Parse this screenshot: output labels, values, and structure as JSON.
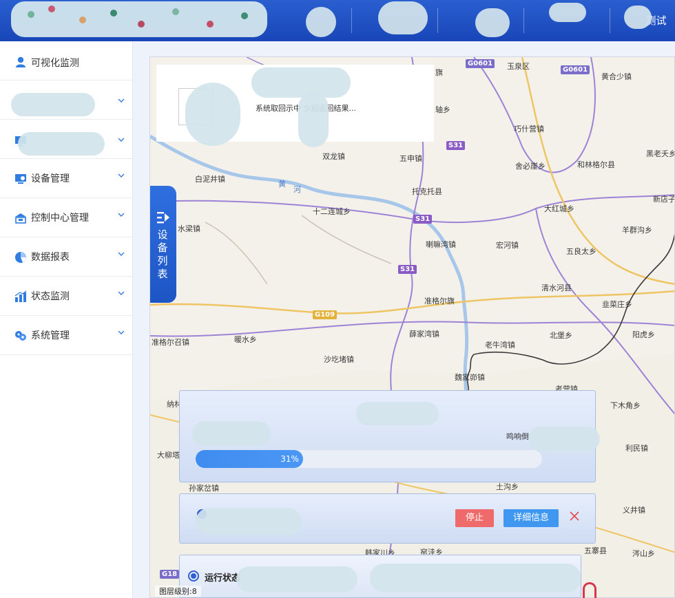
{
  "header": {
    "brand": "",
    "nav": [
      "",
      "",
      "",
      "",
      "测试"
    ]
  },
  "sidebar": {
    "items": [
      {
        "label": "可视化监测",
        "icon": "user-location-icon",
        "chevron": false
      },
      {
        "label": "",
        "icon": "",
        "chevron": true
      },
      {
        "label": "",
        "icon": "monitor-icon",
        "chevron": true
      },
      {
        "label": "设备管理",
        "icon": "device-screen-icon",
        "chevron": true
      },
      {
        "label": "控制中心管理",
        "icon": "building-icon",
        "chevron": true
      },
      {
        "label": "数据报表",
        "icon": "pie-chart-icon",
        "chevron": true
      },
      {
        "label": "状态监测",
        "icon": "bar-chart-icon",
        "chevron": true
      },
      {
        "label": "系统管理",
        "icon": "gear-cluster-icon",
        "chevron": true
      }
    ]
  },
  "notice": {
    "text": "系统取回示中  少后返回结果..."
  },
  "device_tab": {
    "label": "设备列表"
  },
  "progress_panel": {
    "right_text": "鸣响倒",
    "percent_label": "31%",
    "percent": 31
  },
  "action_panel": {
    "stop_label": "停止",
    "detail_label": "详细信息",
    "close_icon": "close-icon"
  },
  "status_panel": {
    "title": "运行状态"
  },
  "map": {
    "scale_label": "图层级别:8",
    "labels": [
      {
        "t": "玉泉区",
        "k": "l1"
      },
      {
        "t": "黄合少镇",
        "k": "l2"
      },
      {
        "t": "巧什营镇",
        "k": "l3"
      },
      {
        "t": "舍必崖乡",
        "k": "l4"
      },
      {
        "t": "和林格尔县",
        "k": "l5"
      },
      {
        "t": "黑老夭乡",
        "k": "l6"
      },
      {
        "t": "双龙镇",
        "k": "l7"
      },
      {
        "t": "五申镇",
        "k": "l8"
      },
      {
        "t": "白泥井镇",
        "k": "l9"
      },
      {
        "t": "托克托县",
        "k": "l10"
      },
      {
        "t": "新店子",
        "k": "l11"
      },
      {
        "t": "十二连城乡",
        "k": "l12"
      },
      {
        "t": "大红城乡",
        "k": "l13"
      },
      {
        "t": "羊群沟乡",
        "k": "l14"
      },
      {
        "t": "水梁镇",
        "k": "l15"
      },
      {
        "t": "喇嘛湾镇",
        "k": "l16"
      },
      {
        "t": "宏河镇",
        "k": "l17"
      },
      {
        "t": "五良太乡",
        "k": "l18"
      },
      {
        "t": "清水河县",
        "k": "l19"
      },
      {
        "t": "准格尔旗",
        "k": "l20"
      },
      {
        "t": "韭菜庄乡",
        "k": "l21"
      },
      {
        "t": "薛家湾镇",
        "k": "l22"
      },
      {
        "t": "准格尔召镇",
        "k": "l23"
      },
      {
        "t": "暖水乡",
        "k": "l24"
      },
      {
        "t": "北堡乡",
        "k": "l25"
      },
      {
        "t": "阳虎乡",
        "k": "l26"
      },
      {
        "t": "老牛湾镇",
        "k": "l27"
      },
      {
        "t": "沙圪堵镇",
        "k": "l28"
      },
      {
        "t": "魏家峁镇",
        "k": "l29"
      },
      {
        "t": "老营镇",
        "k": "l30"
      },
      {
        "t": "下木角乡",
        "k": "l31"
      },
      {
        "t": "利民镇",
        "k": "l32"
      },
      {
        "t": "大柳塔",
        "k": "l33"
      },
      {
        "t": "孙家岔镇",
        "k": "l34"
      },
      {
        "t": "土沟乡",
        "k": "l35"
      },
      {
        "t": "义井镇",
        "k": "l36"
      },
      {
        "t": "五寨县",
        "k": "l37"
      },
      {
        "t": "涔山乡",
        "k": "l38"
      },
      {
        "t": "韩家川乡",
        "k": "l39"
      },
      {
        "t": "窑洼乡",
        "k": "l40"
      },
      {
        "t": "纳林",
        "k": "l41"
      },
      {
        "t": "轴乡",
        "k": "l42"
      },
      {
        "t": "旗",
        "k": "l43"
      },
      {
        "t": "黄",
        "k": "l44"
      },
      {
        "t": "河",
        "k": "l45"
      }
    ],
    "roads": [
      {
        "t": "G0601",
        "k": "r1",
        "color": "#7a6cc9"
      },
      {
        "t": "G0601",
        "k": "r2",
        "color": "#7a6cc9"
      },
      {
        "t": "S31",
        "k": "r3",
        "color": "#8a5bc4"
      },
      {
        "t": "S31",
        "k": "r4",
        "color": "#8a5bc4"
      },
      {
        "t": "S31",
        "k": "r5",
        "color": "#8a5bc4"
      },
      {
        "t": "G109",
        "k": "r6",
        "color": "#e3b23b"
      },
      {
        "t": "G18",
        "k": "r7",
        "color": "#7a6cc9"
      }
    ]
  }
}
